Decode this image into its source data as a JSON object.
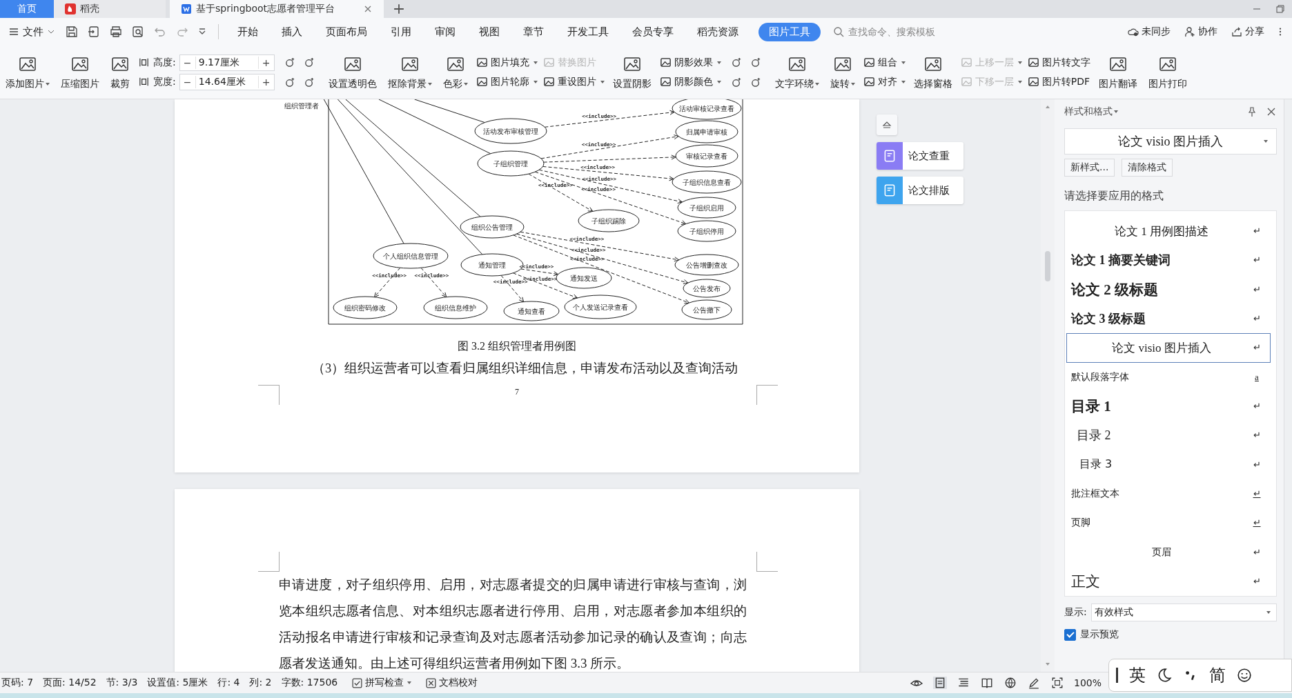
{
  "tabs": [
    {
      "label": "首页",
      "kind": "home",
      "selected": false
    },
    {
      "label": "稻壳",
      "kind": "docer",
      "selected": false
    },
    {
      "label": "基于springboot志愿者管理平台",
      "kind": "doc",
      "selected": true
    }
  ],
  "menu": {
    "file": "文件",
    "tabs": [
      {
        "label": "开始",
        "selected": false
      },
      {
        "label": "插入",
        "selected": false
      },
      {
        "label": "页面布局",
        "selected": false
      },
      {
        "label": "引用",
        "selected": false
      },
      {
        "label": "审阅",
        "selected": false
      },
      {
        "label": "视图",
        "selected": false
      },
      {
        "label": "章节",
        "selected": false
      },
      {
        "label": "开发工具",
        "selected": false
      },
      {
        "label": "会员专享",
        "selected": false
      },
      {
        "label": "稻壳资源",
        "selected": false
      },
      {
        "label": "图片工具",
        "selected": true
      }
    ],
    "search": {
      "placeholder": "查找命令、搜索模板"
    },
    "actions": [
      {
        "kind": "sync",
        "label": "未同步"
      },
      {
        "kind": "collab",
        "label": "协作"
      },
      {
        "kind": "share",
        "label": "分享"
      }
    ]
  },
  "ribbon": [
    {
      "kind": "big",
      "label": "添加图片",
      "caret": true
    },
    {
      "kind": "big",
      "label": "压缩图片",
      "caret": false
    },
    {
      "kind": "big",
      "label": "裁剪",
      "caret": false
    },
    {
      "kind": "size",
      "rows": [
        {
          "label": "高度:",
          "dec": "−",
          "value": "9.17厘米",
          "inc": "+"
        },
        {
          "label": "宽度:",
          "dec": "−",
          "value": "14.64厘米",
          "inc": "+"
        }
      ]
    },
    {
      "kind": "icons"
    },
    {
      "kind": "big",
      "label": "设置透明色",
      "caret": false
    },
    {
      "kind": "big",
      "label": "抠除背景",
      "caret": true
    },
    {
      "kind": "big",
      "label": "色彩",
      "caret": true
    },
    {
      "kind": "stack",
      "items": [
        {
          "label": "图片填充",
          "caret": true,
          "disabled": false
        },
        {
          "label": "图片轮廓",
          "caret": true,
          "disabled": false
        }
      ]
    },
    {
      "kind": "stack",
      "items": [
        {
          "label": "替换图片",
          "caret": false,
          "disabled": true
        },
        {
          "label": "重设图片",
          "caret": true,
          "disabled": false
        }
      ]
    },
    {
      "kind": "big",
      "label": "设置阴影",
      "caret": false
    },
    {
      "kind": "stack",
      "items": [
        {
          "label": "阴影效果",
          "caret": true,
          "disabled": false
        },
        {
          "label": "阴影颜色",
          "caret": true,
          "disabled": false
        }
      ]
    },
    {
      "kind": "icons"
    },
    {
      "kind": "big",
      "label": "文字环绕",
      "caret": true
    },
    {
      "kind": "big",
      "label": "旋转",
      "caret": true
    },
    {
      "kind": "stack",
      "items": [
        {
          "label": "组合",
          "caret": true,
          "disabled": false
        },
        {
          "label": "对齐",
          "caret": true,
          "disabled": false
        }
      ]
    },
    {
      "kind": "big",
      "label": "选择窗格",
      "caret": false
    },
    {
      "kind": "stack",
      "items": [
        {
          "label": "上移一层",
          "caret": true,
          "disabled": true
        },
        {
          "label": "下移一层",
          "caret": true,
          "disabled": true
        }
      ]
    },
    {
      "kind": "stack",
      "items": [
        {
          "label": "图片转文字",
          "caret": false,
          "disabled": false
        },
        {
          "label": "图片转PDF",
          "caret": false,
          "disabled": false
        }
      ]
    },
    {
      "kind": "big",
      "label": "图片翻译",
      "caret": false
    },
    {
      "kind": "big",
      "label": "图片打印",
      "caret": false
    }
  ],
  "document": {
    "diagram": {
      "actor": "组织管理者",
      "nodes": [
        {
          "label": "活动审核记录查看",
          "include_label": "<<include>>"
        },
        {
          "label": "活动发布审核管理"
        },
        {
          "label": "归属申请审核",
          "include_label": "<<include>>"
        },
        {
          "label": "子组织管理"
        },
        {
          "label": "审核记录查看"
        },
        {
          "label": "子组织信息查看",
          "include_label": "<<include>>"
        },
        {
          "label": "子组织启用",
          "include_label": "<<include>>"
        },
        {
          "label": "子组织踢除",
          "include_label": "<<include>>"
        },
        {
          "label": "组织公告管理"
        },
        {
          "label": "子组织停用",
          "include_label": "<<include>>"
        },
        {
          "label": "个人组织信息管理"
        },
        {
          "label": "通知管理"
        },
        {
          "label": "公告增删查改",
          "include_label": "<<include>>"
        },
        {
          "label": "通知发送",
          "include_label": "<<include>>"
        },
        {
          "label": "公告发布",
          "include_label": "<<include>>"
        },
        {
          "label": "组织密码修改",
          "include_label": "<<include>>"
        },
        {
          "label": "组织信息维护",
          "include_label": "<<include>>"
        },
        {
          "label": "通知查看",
          "include_label": "<<include>>"
        },
        {
          "label": "个人发送记录查看",
          "include_label": "<<include>>"
        },
        {
          "label": "公告撤下",
          "include_label": "<<include>>"
        }
      ]
    },
    "caption": "图 3.2  组织管理者用例图",
    "paragraph_1": "（3）组织运营者可以查看归属组织详细信息，申请发布活动以及查询活动",
    "page_number": "7",
    "paragraph_2": "申请进度，对子组织停用、启用，对志愿者提交的归属申请进行审核与查询，浏览本组织志愿者信息、对本组织志愿者进行停用、启用，对志愿者参加本组织的活动报名申请进行审核和记录查询及对志愿者活动参加记录的确认及查询；向志愿者发送通知。由上述可得组织运营者用例如下图 3.3 所示。"
  },
  "side_buttons": [
    {
      "kind": "check",
      "label": "论文查重"
    },
    {
      "kind": "layout",
      "label": "论文排版"
    }
  ],
  "style_panel": {
    "title": "样式和格式",
    "current": "论文 visio 图片插入",
    "buttons": [
      "新样式...",
      "清除格式"
    ],
    "prompt": "请选择要应用的格式",
    "styles": [
      {
        "label": "论文 1 用例图描述",
        "kind": "caption",
        "mark": "↵",
        "selected": false
      },
      {
        "label": "论文 1 摘要关键词",
        "kind": "keyword",
        "mark": "↵",
        "selected": false
      },
      {
        "label": "论文 2 级标题",
        "kind": "heading2",
        "mark": "↵",
        "selected": false
      },
      {
        "label": "论文 3 级标题",
        "kind": "heading3",
        "mark": "↵",
        "selected": false
      },
      {
        "label": "论文 visio 图片插入",
        "kind": "figure",
        "mark": "↵",
        "selected": true
      },
      {
        "label": "默认段落字体",
        "kind": "plain",
        "mark": "a",
        "selected": false
      },
      {
        "label": "目录 1",
        "kind": "toc1",
        "mark": "↵",
        "selected": false
      },
      {
        "label": "目录 2",
        "kind": "toc2",
        "mark": "↵",
        "selected": false
      },
      {
        "label": "目录 3",
        "kind": "toc3",
        "mark": "↵",
        "selected": false
      },
      {
        "label": "批注框文本",
        "kind": "plain",
        "mark": "↵",
        "selected": false
      },
      {
        "label": "页脚",
        "kind": "plain",
        "mark": "↵",
        "selected": false
      },
      {
        "label": "页眉",
        "kind": "header",
        "mark": "↵",
        "selected": false
      },
      {
        "label": "正文",
        "kind": "body",
        "mark": "↵",
        "selected": false
      }
    ],
    "show_label": "显示:",
    "show_value": "有效样式",
    "preview": {
      "label": "显示预览",
      "checked": true
    }
  },
  "status_bar": {
    "items": [
      "页码: 7",
      "页面: 14/52",
      "节: 3/3",
      "设置值: 5厘米",
      "行: 4",
      "列: 2",
      "字数: 17506"
    ],
    "spell": "拼写检查",
    "proof": "文档校对",
    "zoom": "100%"
  },
  "ime": [
    "英",
    "简"
  ]
}
